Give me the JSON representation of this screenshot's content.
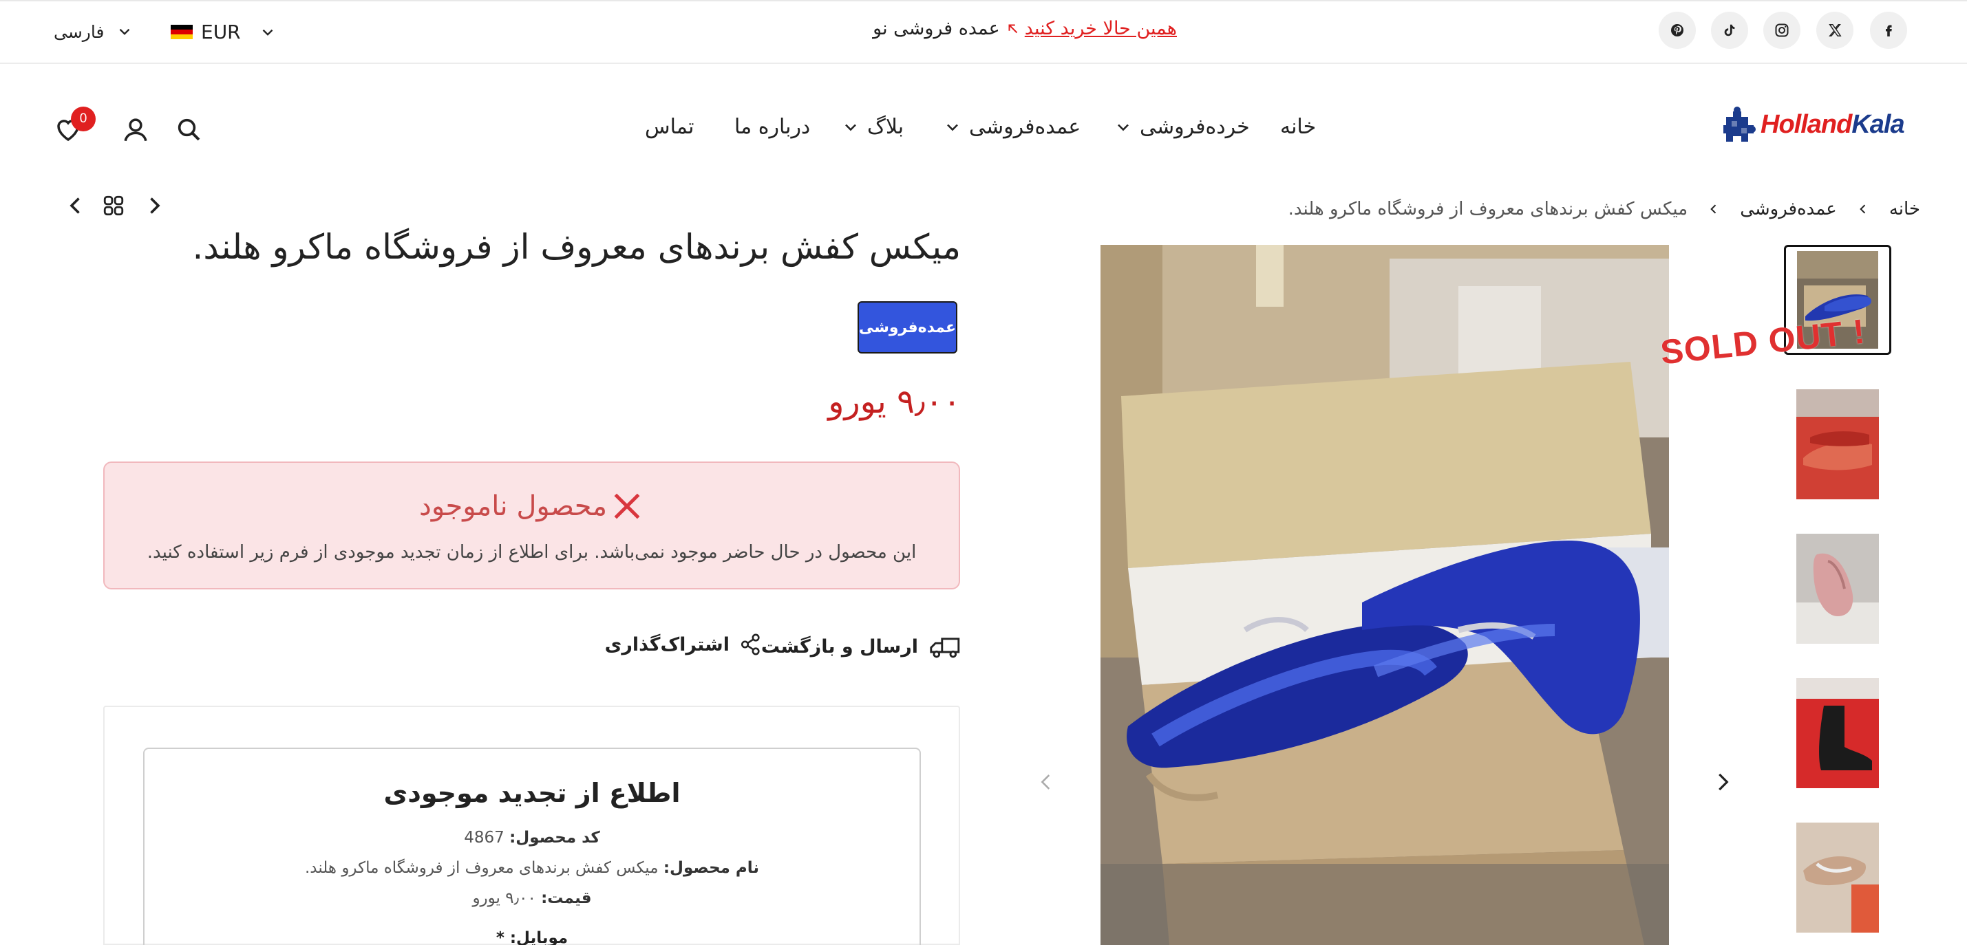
{
  "topbar": {
    "social": [
      "facebook-icon",
      "x-icon",
      "instagram-icon",
      "tiktok-icon",
      "pinterest-icon"
    ],
    "announce_text": "عمده فروشی نو",
    "announce_link": "همین حالا خرید کنید",
    "currency": "EUR",
    "language": "فارسی"
  },
  "header": {
    "logo": {
      "part1": "Holland",
      "part2": "Kala"
    },
    "nav": {
      "home": "خانه",
      "retail": "خرده‌فروشی",
      "wholesale": "عمده‌فروشی",
      "blog": "بلاگ",
      "about": "درباره ما",
      "contact": "تماس"
    },
    "cart_count": "0"
  },
  "breadcrumb": {
    "home": "خانه",
    "category": "عمده‌فروشی",
    "current": "میکس کفش برندهای معروف از فروشگاه ماکرو هلند."
  },
  "gallery": {
    "sold_out": "SOLD OUT !"
  },
  "product": {
    "title": "میکس کفش برندهای معروف از فروشگاه ماکرو هلند.",
    "category_button": "عمده‌فروشی",
    "price": "۹٫۰۰ یورو",
    "out_of_stock_title": "محصول ناموجود",
    "out_of_stock_text": "این محصول در حال حاضر موجود نمی‌باشد. برای اطلاع از زمان تجدید موجودی از فرم زیر استفاده کنید.",
    "shipping_label": "ارسال و بازگشت",
    "share_label": "اشتراک‌گذاری"
  },
  "restock_form": {
    "title": "اطلاع از تجدید موجودی",
    "code_label": "کد محصول:",
    "code_value": "4867",
    "name_label": "نام محصول:",
    "name_value": "میکس کفش برندهای معروف از فروشگاه ماکرو هلند.",
    "price_label": "قیمت:",
    "price_value": "۹٫۰۰ یورو",
    "mobile_label": "موبایل: *"
  },
  "colors": {
    "accent": "#e02020",
    "brand_blue": "#3355dd",
    "alert_bg": "#fbe4e6"
  }
}
